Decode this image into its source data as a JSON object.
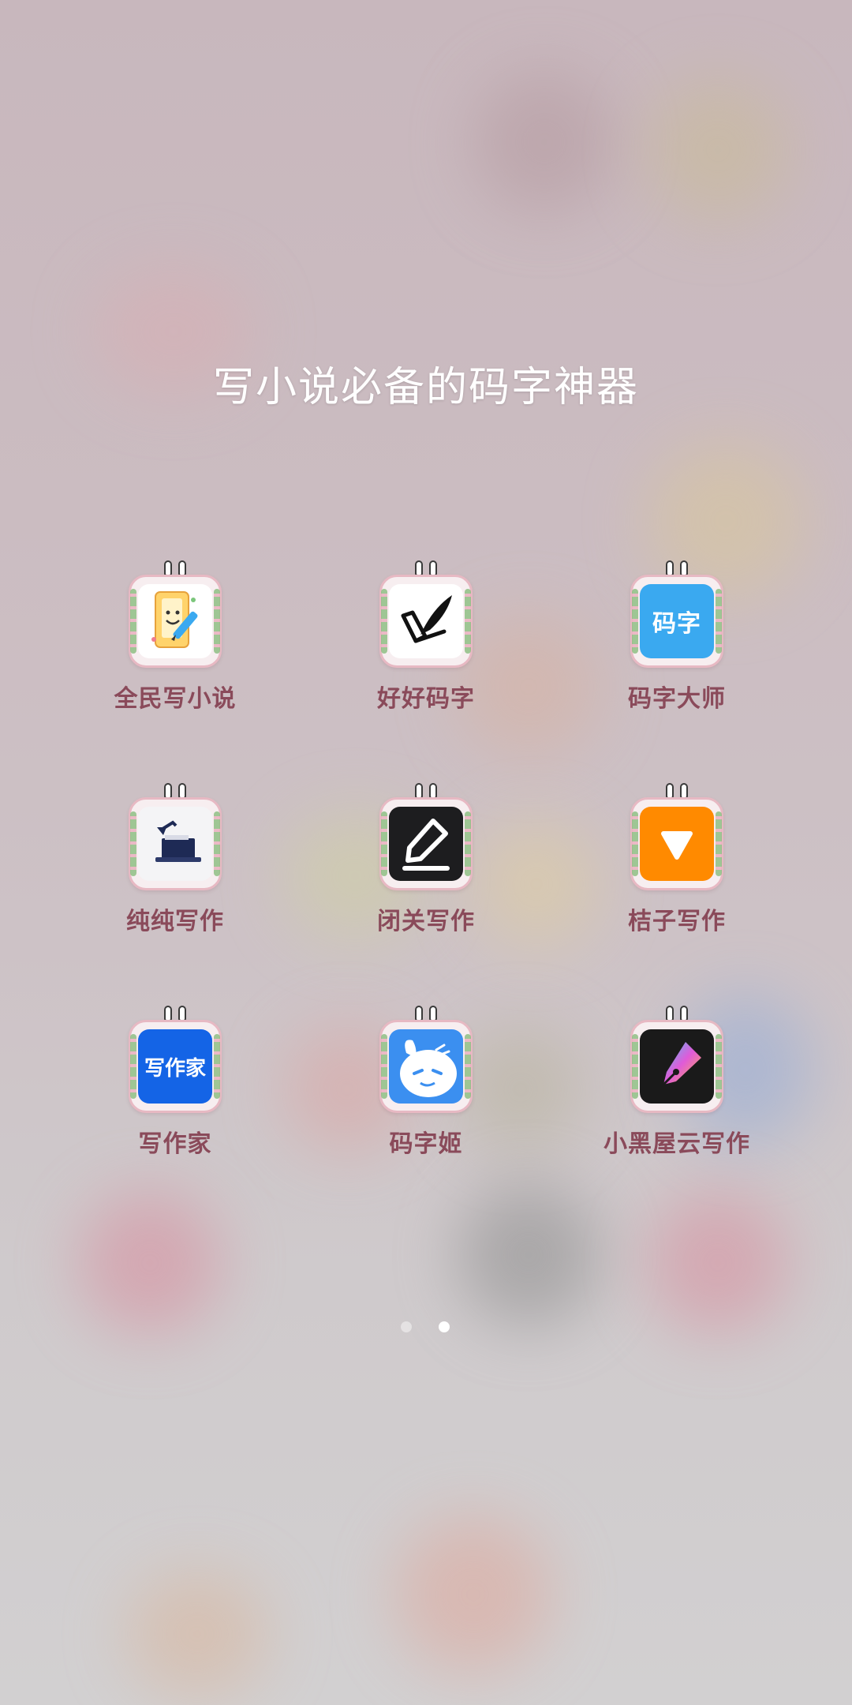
{
  "folder": {
    "title": "写小说必备的码字神器"
  },
  "apps": [
    {
      "label": "全民写小说",
      "icon": "smiley-notebook-pencil-icon",
      "bg": "#ffffff"
    },
    {
      "label": "好好码字",
      "icon": "quill-checkmark-icon",
      "bg": "#ffffff"
    },
    {
      "label": "码字大师",
      "icon": "mazi-text-badge-icon",
      "bg": "#3aa9f0",
      "icon_text": "码字"
    },
    {
      "label": "纯纯写作",
      "icon": "desk-lamp-icon",
      "bg": "#f4f4f6"
    },
    {
      "label": "闭关写作",
      "icon": "pencil-edit-icon",
      "bg": "#1d1d1f"
    },
    {
      "label": "桔子写作",
      "icon": "orange-triangle-icon",
      "bg": "#ff8a00"
    },
    {
      "label": "写作家",
      "icon": "xiezuojia-text-badge-icon",
      "bg": "#1464e6",
      "icon_text": "写作家"
    },
    {
      "label": "码字姬",
      "icon": "bunny-face-icon",
      "bg": "#3b8ff0"
    },
    {
      "label": "小黑屋云写作",
      "icon": "fountain-pen-nib-icon",
      "bg": "#1a1a1a"
    }
  ],
  "pager": {
    "pages": 2,
    "current": 2
  },
  "colors": {
    "label_color": "#8a4a5a",
    "title_color": "#ffffff",
    "frame_border": "#e7b9c3"
  }
}
